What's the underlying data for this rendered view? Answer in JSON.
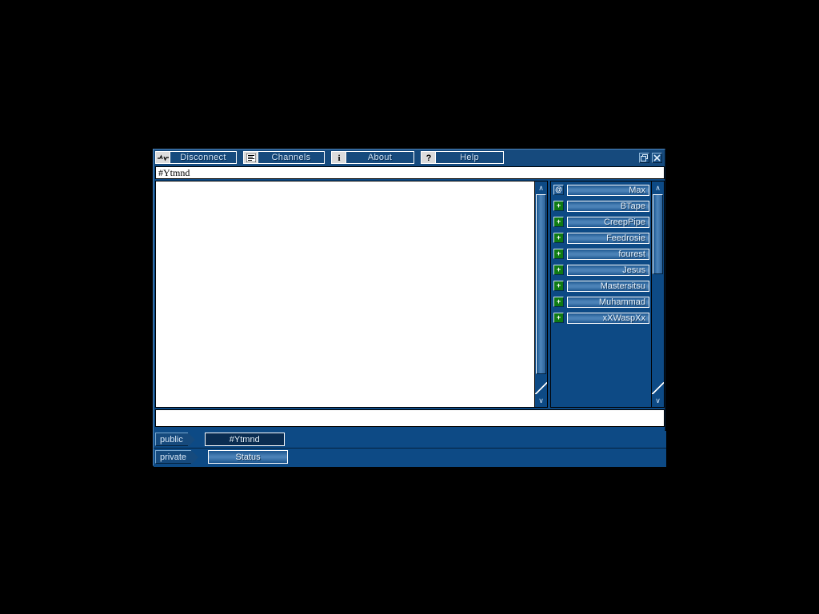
{
  "window": {
    "restore_label": "Restore",
    "close_label": "Close"
  },
  "toolbar": {
    "buttons": [
      {
        "label": "Disconnect",
        "icon": "disconnect-icon"
      },
      {
        "label": "Channels",
        "icon": "list-icon"
      },
      {
        "label": "About",
        "icon": "info-icon"
      },
      {
        "label": "Help",
        "icon": "question-icon"
      }
    ]
  },
  "topic": {
    "text": "#Ytmnd"
  },
  "chat": {
    "messages": [],
    "scroll_up_glyph": "∧",
    "scroll_down_glyph": "∨"
  },
  "nicklist": {
    "users": [
      {
        "name": "Max",
        "mode": "@",
        "mode_type": "op"
      },
      {
        "name": "BTape",
        "mode": "+",
        "mode_type": "voice"
      },
      {
        "name": "CreepPipe",
        "mode": "+",
        "mode_type": "voice"
      },
      {
        "name": "Feedrosie",
        "mode": "+",
        "mode_type": "voice"
      },
      {
        "name": "fourest",
        "mode": "+",
        "mode_type": "voice"
      },
      {
        "name": "Jesus",
        "mode": "+",
        "mode_type": "voice"
      },
      {
        "name": "Mastersitsu",
        "mode": "+",
        "mode_type": "voice"
      },
      {
        "name": "Muhammad",
        "mode": "+",
        "mode_type": "voice"
      },
      {
        "name": "xXWaspXx",
        "mode": "+",
        "mode_type": "voice"
      }
    ]
  },
  "input": {
    "value": "",
    "placeholder": ""
  },
  "tabs": {
    "rows": [
      {
        "tag": "public",
        "button": "#Ytmnd",
        "state": "active"
      },
      {
        "tag": "private",
        "button": "Status",
        "state": "inactive"
      }
    ]
  },
  "colors": {
    "window_bg": "#0d4a85",
    "toolbar_bg": "#164a7d",
    "accent_text": "#cfe2f5",
    "op_badge": "#1d5790",
    "voice_badge": "#0f7a14",
    "chat_bg": "#ffffff",
    "active_tab": "#0a2d52"
  }
}
